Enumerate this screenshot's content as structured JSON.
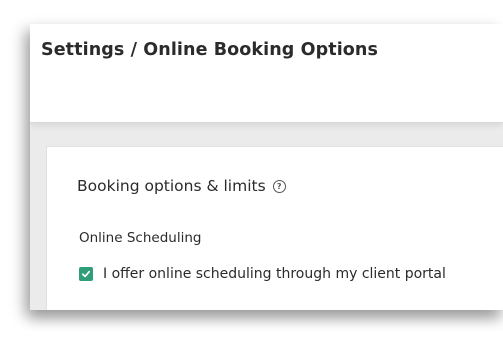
{
  "header": {
    "title": "Settings / Online Booking Options"
  },
  "card": {
    "title": "Booking options & limits",
    "help_icon": "help-circle-icon",
    "help_glyph": "?"
  },
  "online_scheduling": {
    "section_label": "Online Scheduling",
    "checkbox_label": "I offer online scheduling through my client portal",
    "checked": true
  },
  "colors": {
    "checkbox_fill": "#2e9e78",
    "page_background": "#ebebeb",
    "text": "#2b2b2b"
  }
}
